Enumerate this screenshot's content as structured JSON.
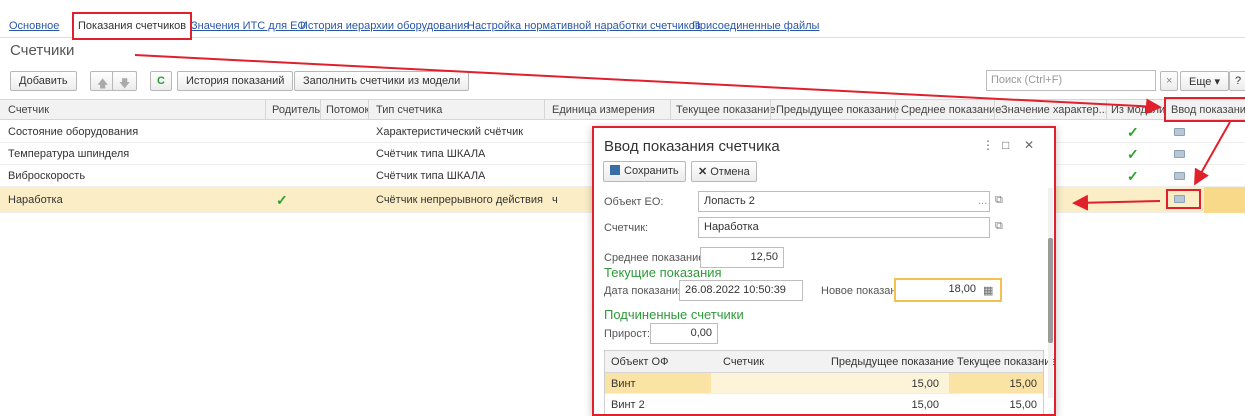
{
  "tabs": [
    {
      "label": "Основное"
    },
    {
      "label": "Показания счетчиков"
    },
    {
      "label": "Значения ИТС для ЕО"
    },
    {
      "label": "История иерархии оборудования"
    },
    {
      "label": "Настройка нормативной наработки счетчиков"
    },
    {
      "label": "Присоединенные файлы"
    }
  ],
  "page_title": "Счетчики",
  "toolbar": {
    "add": "Добавить",
    "up_arrow": "🡅",
    "down_arrow": "🡇",
    "refresh": "C",
    "history": "История показаний",
    "fill": "Заполнить счетчики из модели",
    "search_placeholder": "Поиск (Ctrl+F)",
    "clear": "×",
    "more": "Еще ▾",
    "help": "?"
  },
  "columns": [
    "Счетчик",
    "Родитель",
    "Потомок",
    "Тип счетчика",
    "Единица измерения",
    "Текущее показание",
    "Предыдущее показание",
    "Среднее показание",
    "Значение характер...",
    "Из модели",
    "Ввод показания"
  ],
  "rows": [
    {
      "name": "Состояние оборудования",
      "type": "Характеристический счётчик",
      "unit": ""
    },
    {
      "name": "Температура шпинделя",
      "type": "Счётчик типа ШКАЛА",
      "unit": ""
    },
    {
      "name": "Виброскорость",
      "type": "Счётчик типа ШКАЛА",
      "unit": ""
    },
    {
      "name": "Наработка",
      "type": "Счётчик непрерывного действия",
      "unit": "ч"
    }
  ],
  "dialog": {
    "title": "Ввод показания счетчика",
    "menu": "⋮",
    "maximize": "□",
    "close": "✕",
    "save": "Сохранить",
    "cancel": "Отмена",
    "object_label": "Объект ЕО:",
    "object_value": "Лопасть 2",
    "counter_label": "Счетчик:",
    "counter_value": "Наработка",
    "avg_label": "Среднее показание:",
    "avg_value": "12,50",
    "current_section": "Текущие показания",
    "date_label": "Дата показания:",
    "date_value": "26.08.2022 10:50:39",
    "new_label": "Новое показание:",
    "new_value": "18,00",
    "sub_section": "Подчиненные счетчики",
    "increment_label": "Прирост:",
    "increment_value": "0,00",
    "sub_columns": [
      "Объект ОФ",
      "Счетчик",
      "Предыдущее показание",
      "Текущее показание"
    ],
    "sub_rows": [
      {
        "object": "Винт",
        "counter": "",
        "prev": "15,00",
        "curr": "15,00"
      },
      {
        "object": "Винт 2",
        "counter": "",
        "prev": "15,00",
        "curr": "15,00"
      }
    ]
  },
  "colors": {
    "highlight": "#e0202a",
    "check": "#2ea02e",
    "section": "#2e9a3a"
  }
}
